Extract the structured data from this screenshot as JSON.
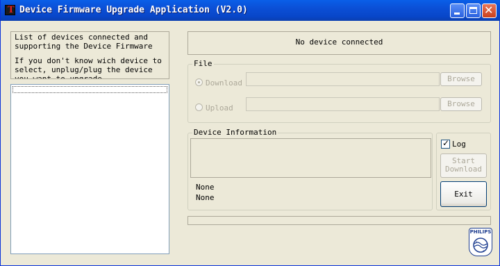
{
  "window": {
    "title": "Device Firmware Upgrade Application (V2.0)",
    "icon_letter": "T",
    "controls": [
      "minimize-icon",
      "maximize-icon",
      "close-icon"
    ]
  },
  "instructions": {
    "line1": "List of devices connected and supporting the Device Firmware",
    "line2": "If you don't know wich device to select, unplug/plug the device you want to upgrade"
  },
  "device_list": {
    "items": []
  },
  "status": {
    "text": "No device connected"
  },
  "file_group": {
    "label": "File",
    "download_label": "Download",
    "download_selected": true,
    "download_path": "",
    "upload_label": "Upload",
    "upload_selected": false,
    "upload_path": "",
    "browse_label": "Browse"
  },
  "device_info": {
    "label": "Device Information",
    "text": "",
    "line1": "None",
    "line2": "None"
  },
  "actions": {
    "log_label": "Log",
    "log_checked": true,
    "start_download_label": "Start Download",
    "exit_label": "Exit"
  },
  "progress": {
    "value": 0
  },
  "logo": {
    "text": "PHILIPS"
  }
}
